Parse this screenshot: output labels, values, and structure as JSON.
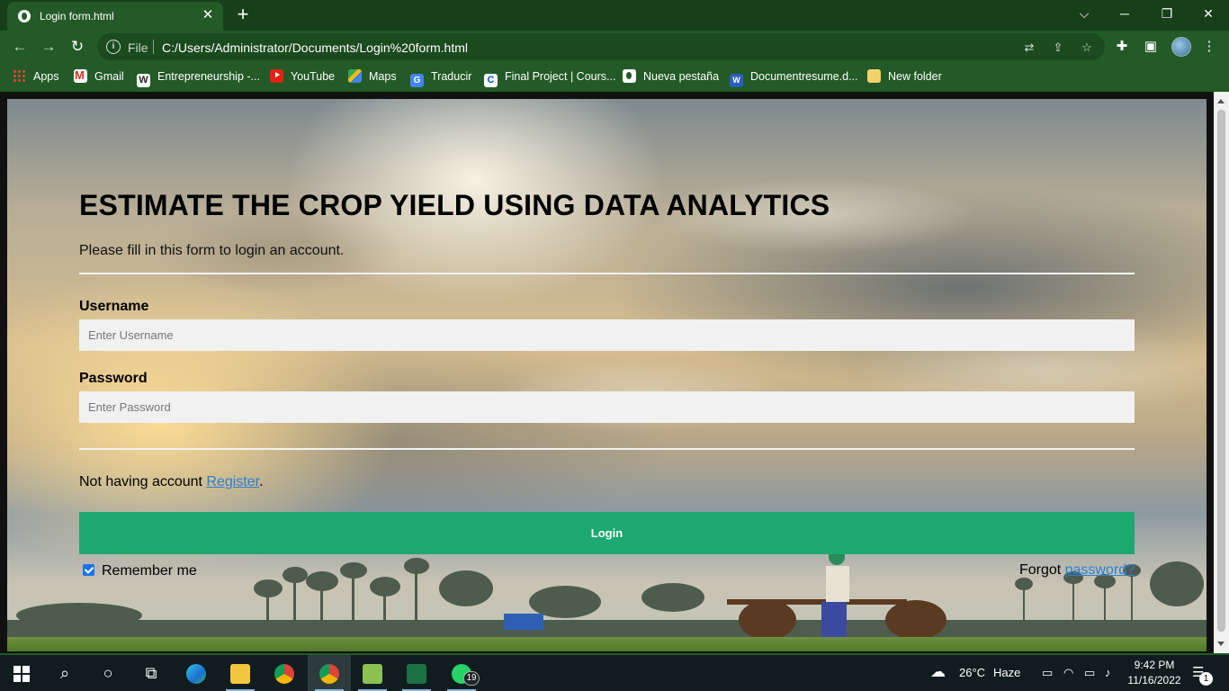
{
  "browser": {
    "tab": {
      "title": "Login form.html",
      "close": "✕"
    },
    "new_tab": "+",
    "window_controls": [
      "⌵",
      "─",
      "❐",
      "✕"
    ],
    "nav": {
      "back": "←",
      "forward": "→",
      "reload": "↻"
    },
    "address": {
      "scheme": "File",
      "url": "C:/Users/Administrator/Documents/Login%20form.html"
    },
    "toolbar_icons": [
      "translate-icon",
      "share-icon",
      "bookmark-star-icon",
      "extensions-icon",
      "side-panel-icon",
      "profile-avatar",
      "menu-icon"
    ],
    "bookmarks": [
      {
        "label": "Apps",
        "icon": "apps-grid-icon"
      },
      {
        "label": "Gmail",
        "icon": "gmail-icon"
      },
      {
        "label": "Entrepreneurship -...",
        "icon": "wikipedia-icon"
      },
      {
        "label": "YouTube",
        "icon": "youtube-icon"
      },
      {
        "label": "Maps",
        "icon": "maps-icon"
      },
      {
        "label": "Traducir",
        "icon": "translate-icon"
      },
      {
        "label": "Final Project | Cours...",
        "icon": "coursera-icon"
      },
      {
        "label": "Nueva pestaña",
        "icon": "globe-icon"
      },
      {
        "label": "Documentresume.d...",
        "icon": "word-icon"
      },
      {
        "label": "New folder",
        "icon": "folder-icon"
      }
    ]
  },
  "page": {
    "heading": "ESTIMATE THE CROP YIELD USING DATA ANALYTICS",
    "subtext": "Please fill in this form to login an account.",
    "username": {
      "label": "Username",
      "placeholder": "Enter Username",
      "value": ""
    },
    "password": {
      "label": "Password",
      "placeholder": "Enter Password",
      "value": ""
    },
    "register": {
      "prefix": "Not having account ",
      "link": "Register",
      "suffix": "."
    },
    "login_button": "Login",
    "remember": {
      "label": "Remember me",
      "checked": true
    },
    "forgot": {
      "prefix": "Forgot ",
      "link": "password?"
    },
    "colors": {
      "login_button": "#1ca86f",
      "link": "#2c80d6",
      "field_bg": "#f1f1f1"
    }
  },
  "taskbar": {
    "weather": {
      "temp": "26°C",
      "condition": "Haze"
    },
    "clock": {
      "time": "9:42 PM",
      "date": "11/16/2022"
    },
    "whatsapp_badge": "19",
    "notifications_badge": "1"
  }
}
